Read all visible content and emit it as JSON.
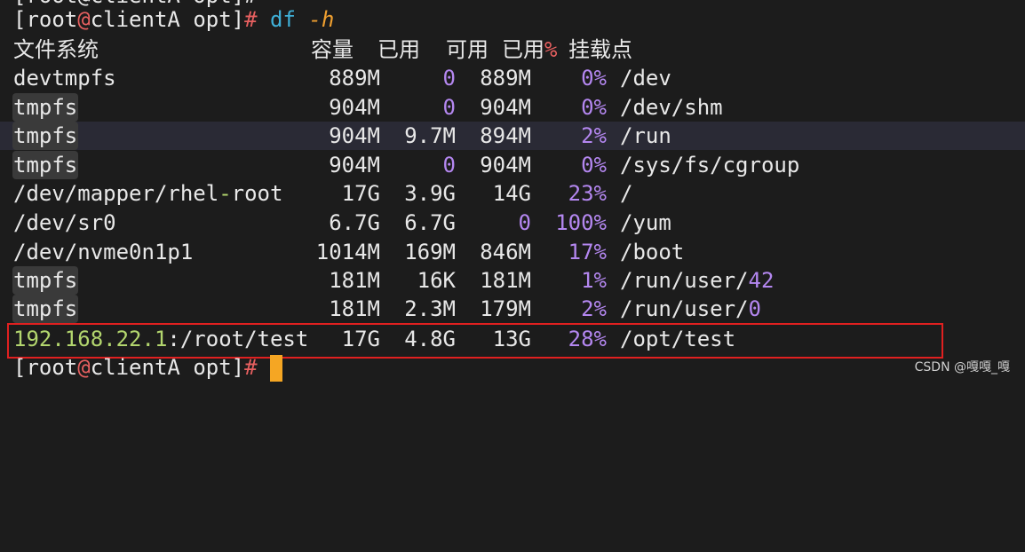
{
  "prompt": {
    "user": "root",
    "at": "@",
    "host": "clientA",
    "dir": "opt",
    "hash": "#",
    "command": "df",
    "option": "-h"
  },
  "header": {
    "filesystem": "文件系统",
    "size": "容量",
    "used": "已用",
    "avail": "可用",
    "use_pct_label": "已用",
    "pct_sign": "%",
    "mounted": "挂载点"
  },
  "rows": [
    {
      "fs": "devtmpfs",
      "size": "889M",
      "used": "0",
      "avail": "889M",
      "pct": "0%",
      "mount": "/dev"
    },
    {
      "fs": "tmpfs",
      "size": "904M",
      "used": "0",
      "avail": "904M",
      "pct": "0%",
      "mount": "/dev/shm"
    },
    {
      "fs": "tmpfs",
      "size": "904M",
      "used": "9.7M",
      "avail": "894M",
      "pct": "2%",
      "mount": "/run"
    },
    {
      "fs": "tmpfs",
      "size": "904M",
      "used": "0",
      "avail": "904M",
      "pct": "0%",
      "mount": "/sys/fs/cgroup"
    },
    {
      "fs_a": "/dev/mapper/rhel",
      "fs_b": "-",
      "fs_c": "root",
      "size": "17G",
      "used": "3.9G",
      "avail": "14G",
      "pct": "23%",
      "mount": "/"
    },
    {
      "fs": "/dev/sr0",
      "size": "6.7G",
      "used": "6.7G",
      "avail": "0",
      "pct": "100%",
      "mount": "/yum"
    },
    {
      "fs": "/dev/nvme0n1p1",
      "size": "1014M",
      "used": "169M",
      "avail": "846M",
      "pct": "17%",
      "mount": "/boot"
    },
    {
      "fs": "tmpfs",
      "size": "181M",
      "used": "16K",
      "avail": "181M",
      "pct": "1%",
      "mount_a": "/run/user/",
      "mount_b": "42"
    },
    {
      "fs": "tmpfs",
      "size": "181M",
      "used": "2.3M",
      "avail": "179M",
      "pct": "2%",
      "mount_a": "/run/user/",
      "mount_b": "0"
    },
    {
      "fs_a": "192.168.22.1",
      "fs_b": ":/root/test",
      "size": "17G",
      "used": "4.8G",
      "avail": "13G",
      "pct": "28%",
      "mount": "/opt/test"
    }
  ],
  "watermark": "CSDN @嘎嘎_嘎",
  "colors": {
    "background": "#1c1c1c",
    "number": "#b487f0",
    "ip": "#b3d66e",
    "command": "#3fb0d8",
    "option": "#f0a030",
    "highlight_box": "#e02020",
    "cursor": "#f5a623"
  }
}
